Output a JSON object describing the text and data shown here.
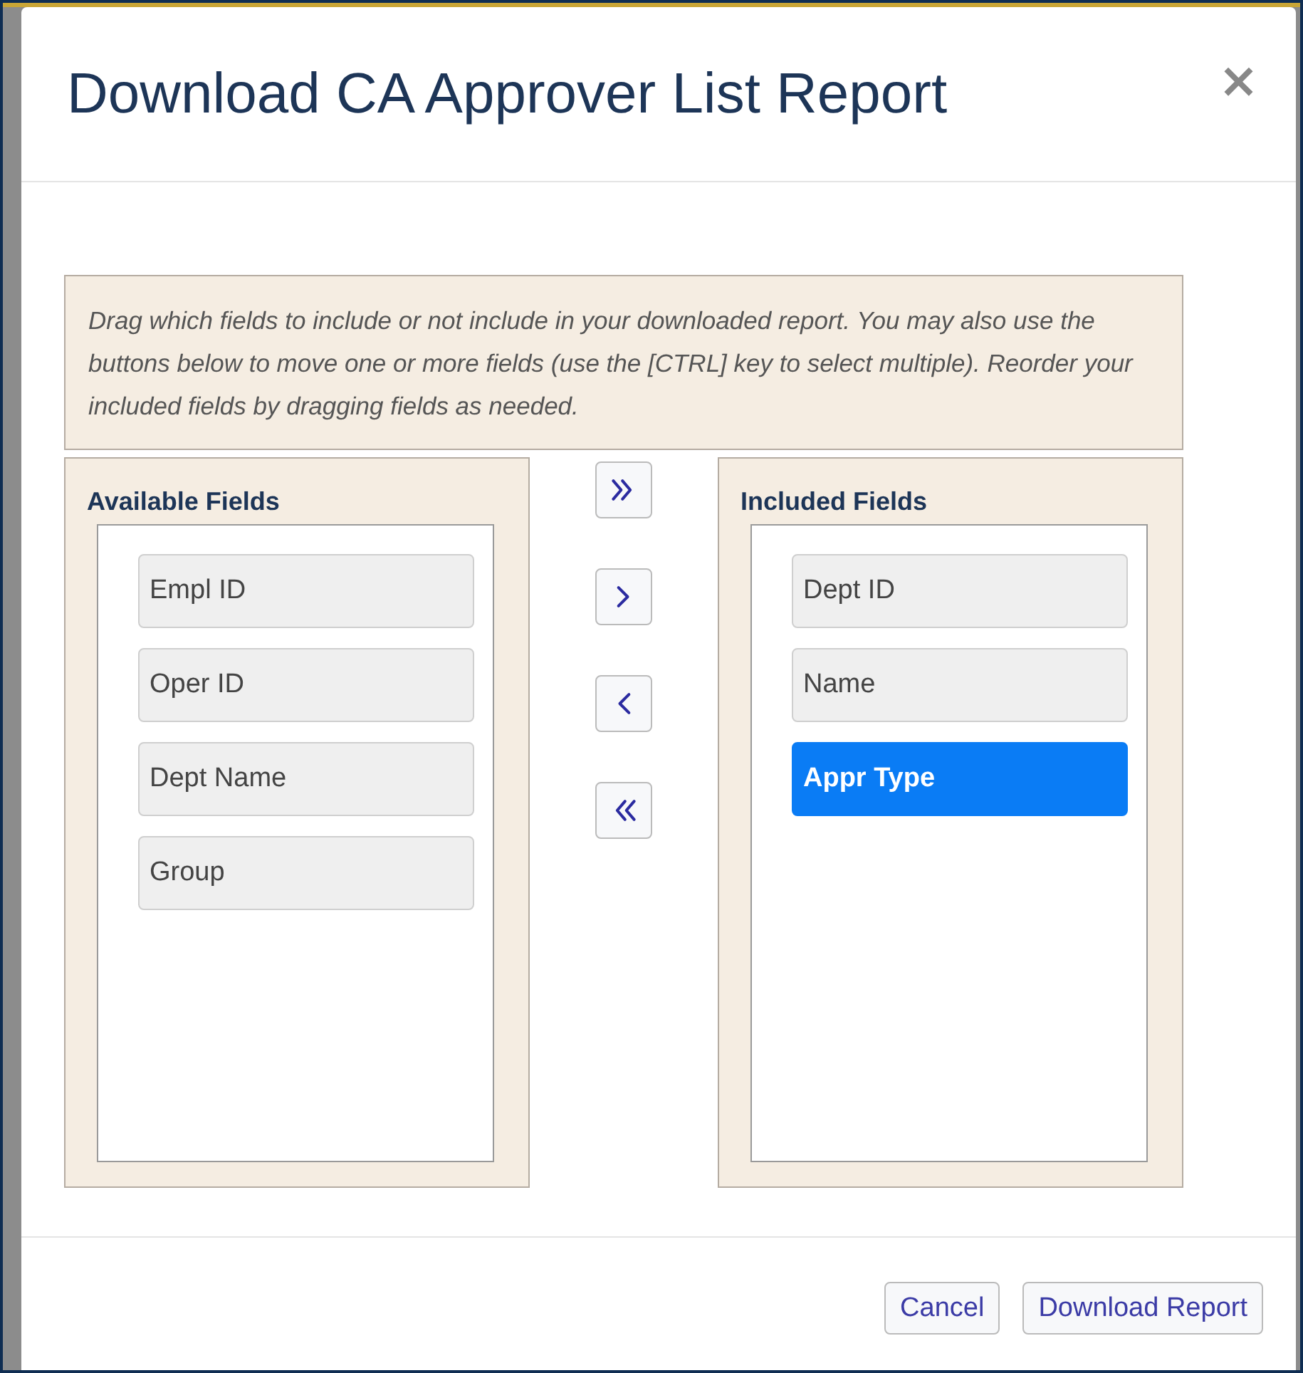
{
  "dialog": {
    "title": "Download CA Approver List Report",
    "close_button": "×",
    "instructions": "Drag which fields to include or not include in your downloaded report. You may also use the buttons below to move one or more fields (use the [CTRL] key to select multiple). Reorder your included fields by dragging fields as needed.",
    "available_fields": {
      "heading": "Available Fields",
      "items": [
        {
          "label": "Empl ID",
          "selected": false
        },
        {
          "label": "Oper ID",
          "selected": false
        },
        {
          "label": "Dept Name",
          "selected": false
        },
        {
          "label": "Group",
          "selected": false
        }
      ]
    },
    "move_buttons": [
      {
        "kind": "move-all-right"
      },
      {
        "kind": "move-right"
      },
      {
        "kind": "move-left"
      },
      {
        "kind": "move-all-left"
      }
    ],
    "included_fields": {
      "heading": "Included Fields",
      "items": [
        {
          "label": "Dept ID",
          "selected": false
        },
        {
          "label": "Name",
          "selected": false
        },
        {
          "label": "Appr Type",
          "selected": true
        }
      ]
    },
    "footer_buttons": [
      "Cancel",
      "Download Report"
    ]
  }
}
